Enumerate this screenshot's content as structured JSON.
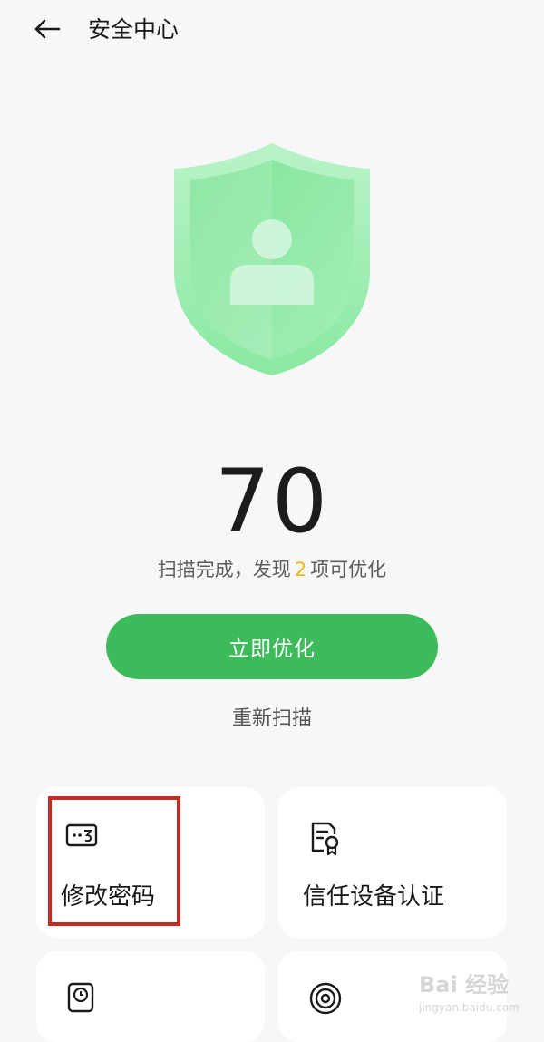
{
  "header": {
    "title": "安全中心",
    "back_icon": "arrow-left-icon"
  },
  "hero": {
    "shield_icon": "shield-user-icon",
    "score": "70",
    "summary_prefix": "扫描完成，发现",
    "summary_count": "2",
    "summary_suffix": "项可优化",
    "colors": {
      "shield": "#7ee59a",
      "accent_count": "#f0b414"
    }
  },
  "actions": {
    "optimize_label": "立即优化",
    "rescan_label": "重新扫描",
    "optimize_color": "#3dbb5a"
  },
  "cards": [
    {
      "label": "修改密码",
      "icon": "password-icon"
    },
    {
      "label": "信任设备认证",
      "icon": "certificate-icon"
    },
    {
      "label": "",
      "icon": "clock-device-icon"
    },
    {
      "label": "",
      "icon": "target-icon"
    }
  ],
  "annotation": {
    "highlight_color": "#c22a22"
  },
  "watermark": {
    "logo": "Bai 经验",
    "sub": "jingyan.baidu.com"
  }
}
